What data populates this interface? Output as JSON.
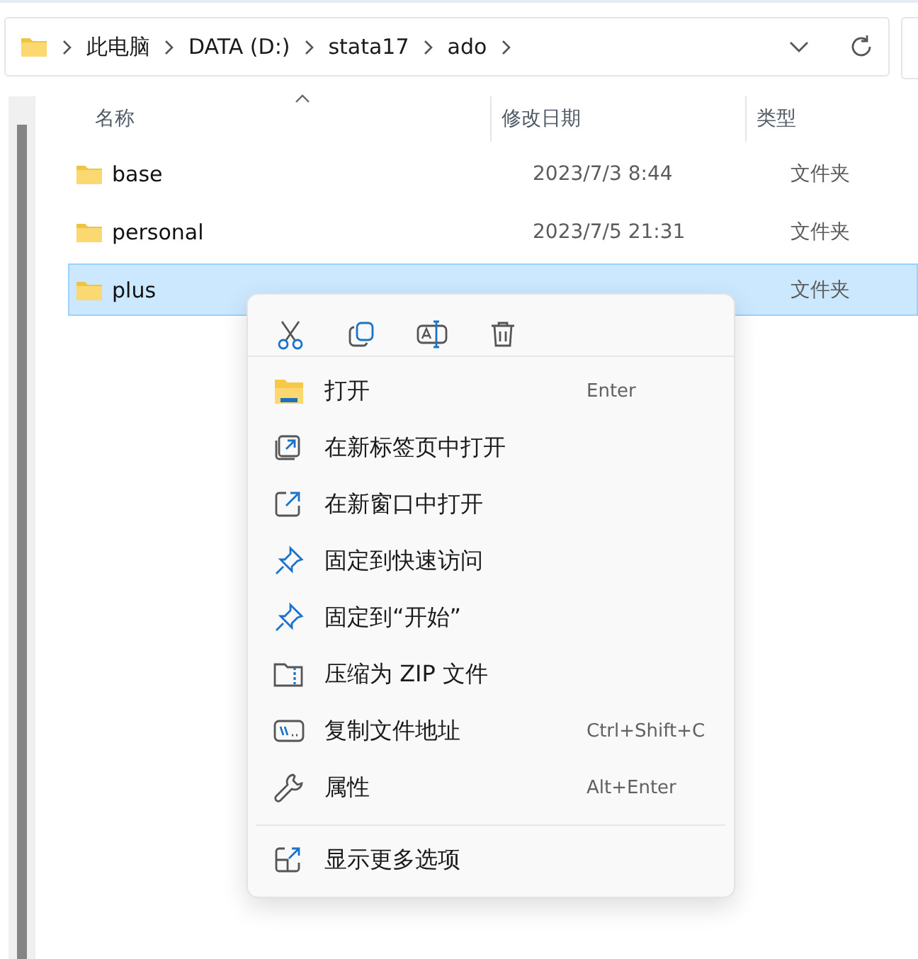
{
  "address_bar": {
    "crumbs": [
      "此电脑",
      "DATA (D:)",
      "stata17",
      "ado"
    ]
  },
  "table": {
    "columns": [
      "名称",
      "修改日期",
      "类型"
    ],
    "rows": [
      {
        "name": "base",
        "date": "2023/7/3 8:44",
        "type": "文件夹",
        "selected": false
      },
      {
        "name": "personal",
        "date": "2023/7/5 21:31",
        "type": "文件夹",
        "selected": false
      },
      {
        "name": "plus",
        "type": "文件夹",
        "selected": true
      }
    ]
  },
  "context_menu": {
    "items": [
      {
        "label": "打开",
        "shortcut": "Enter"
      },
      {
        "label": "在新标签页中打开"
      },
      {
        "label": "在新窗口中打开"
      },
      {
        "label": "固定到快速访问"
      },
      {
        "label": "固定到“开始”"
      },
      {
        "label": "压缩为 ZIP 文件"
      },
      {
        "label": "复制文件地址",
        "shortcut": "Ctrl+Shift+C"
      },
      {
        "label": "属性",
        "shortcut": "Alt+Enter"
      }
    ],
    "extra_item": {
      "label": "显示更多选项"
    }
  }
}
